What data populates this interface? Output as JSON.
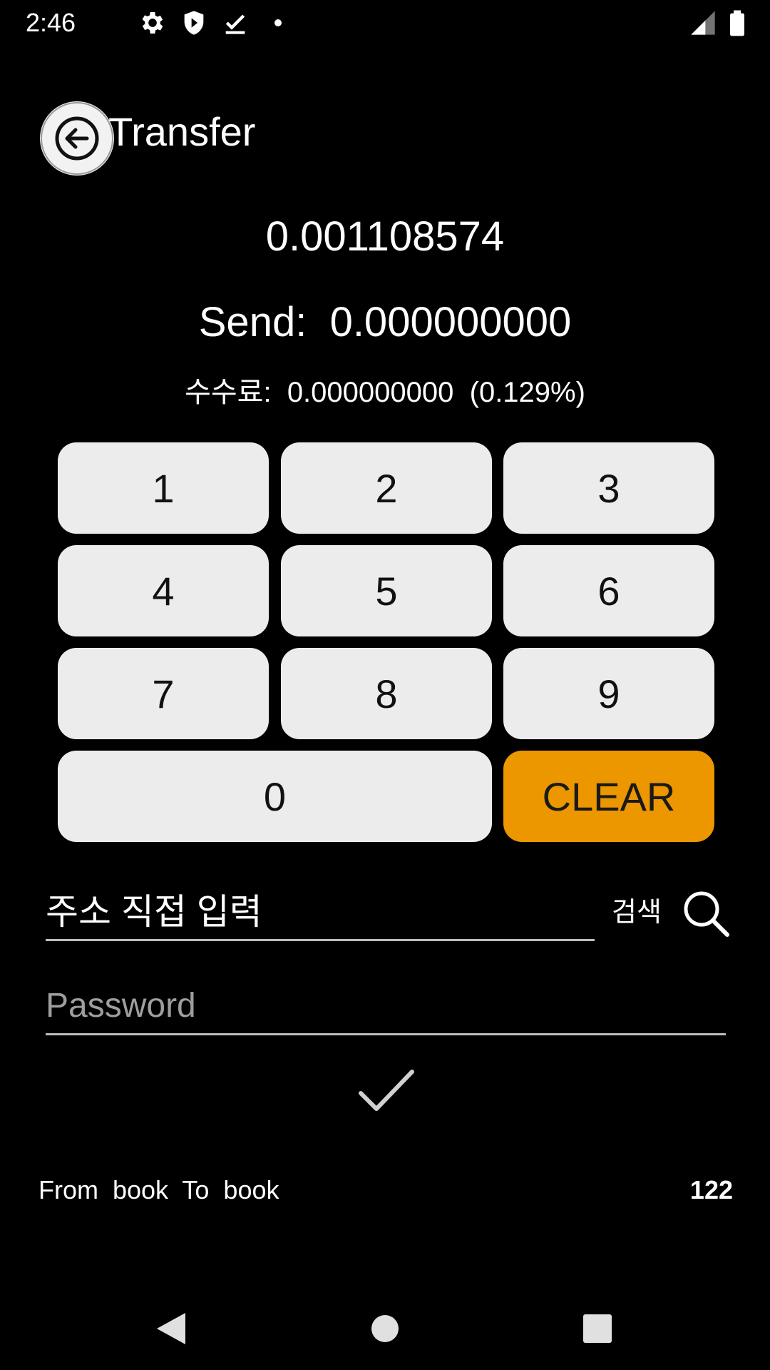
{
  "status_bar": {
    "time": "2:46",
    "icons": [
      "settings-icon",
      "shield-icon",
      "download-done-icon",
      "dot-icon"
    ],
    "right_icons": [
      "signal-icon",
      "battery-icon"
    ]
  },
  "toolbar": {
    "back_icon": "arrow-back-icon",
    "title": "Transfer"
  },
  "balance": "0.001108574",
  "send": {
    "label": "Send:",
    "value": "0.000000000"
  },
  "fee": {
    "label": "수수료:",
    "value": "0.000000000",
    "rate": "(0.129%)"
  },
  "keypad": {
    "keys": [
      "1",
      "2",
      "3",
      "4",
      "5",
      "6",
      "7",
      "8",
      "9",
      "0"
    ],
    "clear_label": "CLEAR",
    "clear_color": "#ec9600"
  },
  "address": {
    "placeholder": "주소 직접 입력",
    "search_label": "검색",
    "search_icon": "search-icon"
  },
  "password": {
    "placeholder": "Password"
  },
  "confirm_icon": "check-icon",
  "list": {
    "label": "From  book  To  book",
    "count": "122"
  },
  "nav": [
    "back-triangle-icon",
    "home-circle-icon",
    "recents-square-icon"
  ]
}
